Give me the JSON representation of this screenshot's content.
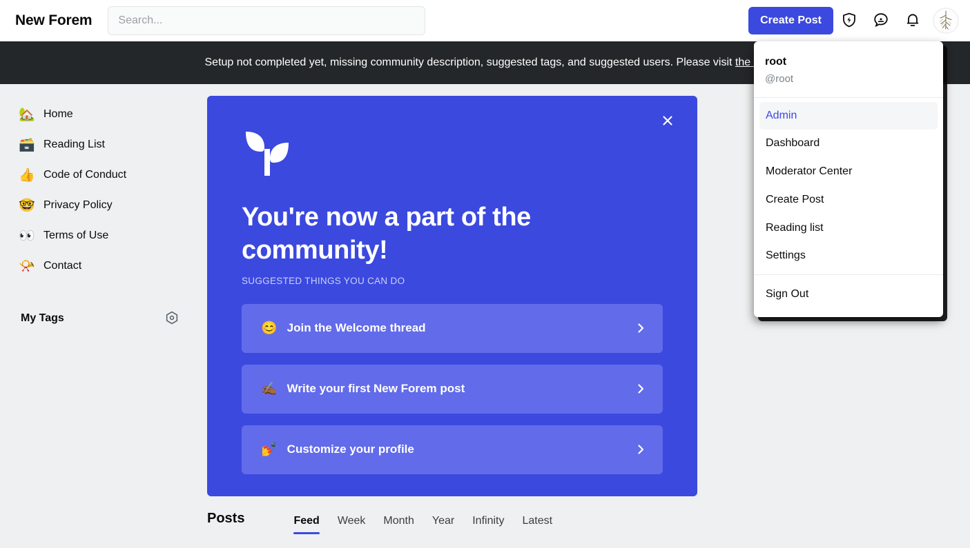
{
  "header": {
    "brand": "New Forem",
    "search_placeholder": "Search...",
    "search_value": "",
    "create_post_label": "Create Post",
    "icons": [
      {
        "name": "shield-lightning-icon",
        "title": "Moderation"
      },
      {
        "name": "chat-bubble-icon",
        "title": "Chat"
      },
      {
        "name": "bell-icon",
        "title": "Notifications"
      }
    ],
    "avatar_alt": "root avatar"
  },
  "banner": {
    "text": "Setup not completed yet, missing community description, suggested tags, and suggested users. Please visit ",
    "link_text": "the co"
  },
  "user_dropdown": {
    "name": "root",
    "handle": "@root",
    "items": [
      {
        "label": "Admin",
        "active": true
      },
      {
        "label": "Dashboard",
        "active": false
      },
      {
        "label": "Moderator Center",
        "active": false
      },
      {
        "label": "Create Post",
        "active": false
      },
      {
        "label": "Reading list",
        "active": false
      },
      {
        "label": "Settings",
        "active": false
      }
    ],
    "sign_out_label": "Sign Out"
  },
  "sidebar": {
    "items": [
      {
        "emoji": "🏡",
        "label": "Home",
        "icon_name": "house-with-garden-icon"
      },
      {
        "emoji": "🗃️",
        "label": "Reading List",
        "icon_name": "card-file-box-icon"
      },
      {
        "emoji": "👍",
        "label": "Code of Conduct",
        "icon_name": "thumbs-up-icon"
      },
      {
        "emoji": "🤓",
        "label": "Privacy Policy",
        "icon_name": "nerd-face-icon"
      },
      {
        "emoji": "👀",
        "label": "Terms of Use",
        "icon_name": "eyes-icon"
      },
      {
        "emoji": "📯",
        "label": "Contact",
        "icon_name": "postal-horn-icon"
      }
    ],
    "tags_title": "My Tags",
    "tags_settings_name": "tag-settings-icon"
  },
  "welcome_card": {
    "title": "You're now a part of the community!",
    "subtitle": "SUGGESTED THINGS YOU CAN DO",
    "close_label": "×",
    "logo_name": "sprout-logo",
    "actions": [
      {
        "emoji": "😊",
        "label": "Join the Welcome thread",
        "icon_name": "smiling-face-icon"
      },
      {
        "emoji": "✍🏾",
        "label": "Write your first New Forem post",
        "icon_name": "writing-hand-icon"
      },
      {
        "emoji": "💅",
        "label": "Customize your profile",
        "icon_name": "nail-polish-icon"
      }
    ]
  },
  "posts_section": {
    "title": "Posts",
    "tabs": [
      {
        "label": "Feed",
        "active": true
      },
      {
        "label": "Week",
        "active": false
      },
      {
        "label": "Month",
        "active": false
      },
      {
        "label": "Year",
        "active": false
      },
      {
        "label": "Infinity",
        "active": false
      },
      {
        "label": "Latest",
        "active": false
      }
    ]
  },
  "colors": {
    "brand_blue": "#3b49df",
    "card_action_blue": "#626bea",
    "banner_dark": "#242729",
    "page_bg": "#eef0f1",
    "accent_link": "#3b49df"
  }
}
